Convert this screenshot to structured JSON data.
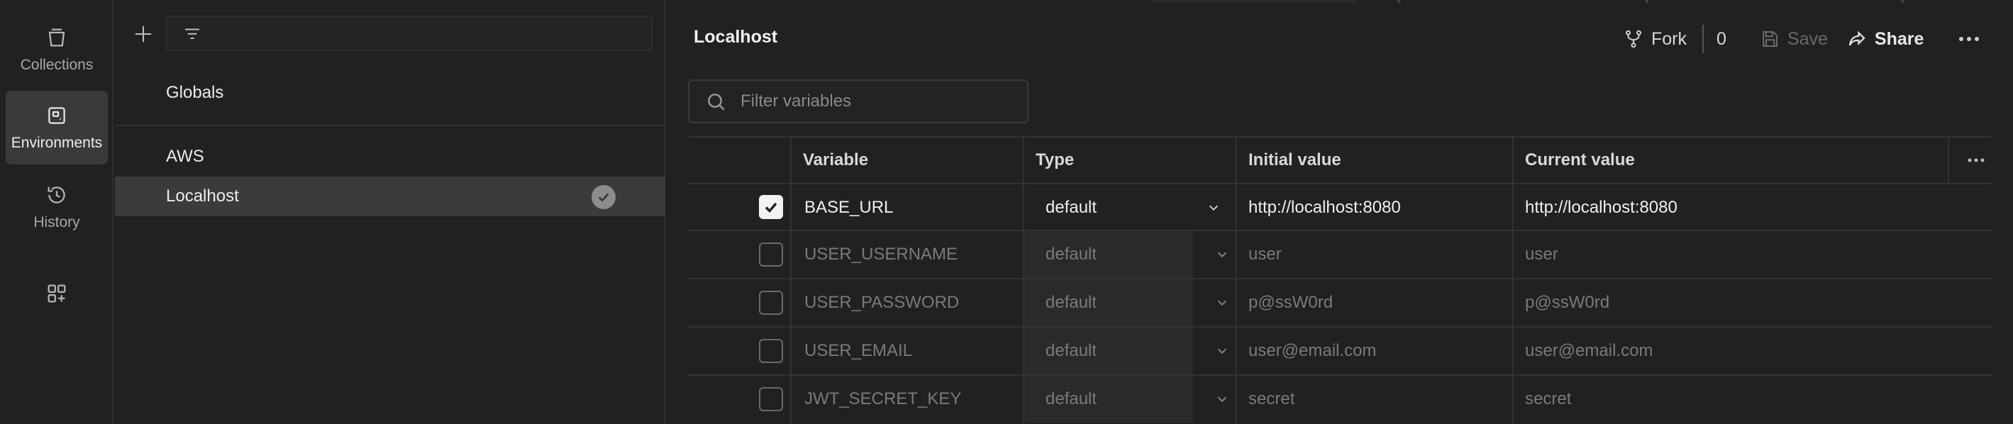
{
  "sidebar": {
    "items": [
      {
        "label": "Collections",
        "icon": "collections-icon"
      },
      {
        "label": "Environments",
        "icon": "environments-icon",
        "active": true
      },
      {
        "label": "History",
        "icon": "history-icon"
      },
      {
        "label": "",
        "icon": "add-workbench-icon"
      }
    ]
  },
  "environments": {
    "globals": "Globals",
    "items": [
      {
        "name": "AWS"
      },
      {
        "name": "Localhost",
        "selected": true,
        "active": true
      }
    ]
  },
  "header": {
    "title": "Localhost",
    "fork_label": "Fork",
    "fork_count": "0",
    "save_label": "Save",
    "share_label": "Share"
  },
  "filter": {
    "placeholder": "Filter variables"
  },
  "table": {
    "columns": [
      "Variable",
      "Type",
      "Initial value",
      "Current value"
    ],
    "rows": [
      {
        "enabled": true,
        "variable": "BASE_URL",
        "type": "default",
        "initial": "http://localhost:8080",
        "current": "http://localhost:8080"
      },
      {
        "enabled": false,
        "variable": "USER_USERNAME",
        "type": "default",
        "initial": "user",
        "current": "user"
      },
      {
        "enabled": false,
        "variable": "USER_PASSWORD",
        "type": "default",
        "initial": "p@ssW0rd",
        "current": "p@ssW0rd"
      },
      {
        "enabled": false,
        "variable": "USER_EMAIL",
        "type": "default",
        "initial": "user@email.com",
        "current": "user@email.com"
      },
      {
        "enabled": false,
        "variable": "JWT_SECRET_KEY",
        "type": "default",
        "initial": "secret",
        "current": "secret"
      }
    ]
  },
  "colors": {
    "background": "#212121",
    "selected_row": "#3b3b3b",
    "text": "#e6e6e6",
    "muted_text": "#7a7a7a"
  }
}
